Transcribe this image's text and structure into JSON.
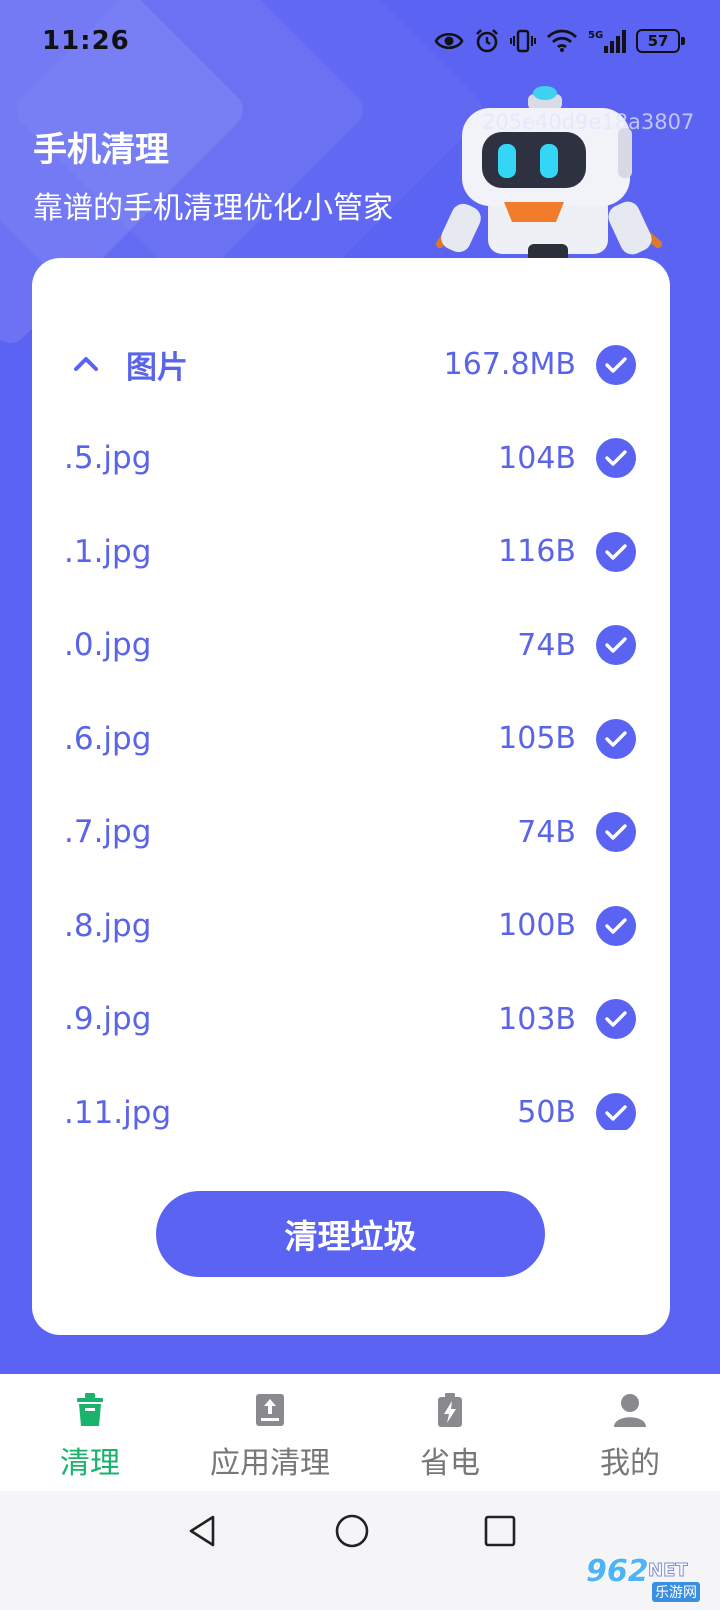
{
  "status_bar": {
    "time": "11:26",
    "battery": "57"
  },
  "header": {
    "title": "手机清理",
    "subtitle": "靠谱的手机清理优化小管家",
    "overlay_id": "205e40d9e18a3807"
  },
  "file_list": {
    "group": {
      "name": "图片",
      "size": "167.8MB",
      "checked": true,
      "expanded": true
    },
    "items": [
      {
        "name": ".5.jpg",
        "size": "104B",
        "checked": true
      },
      {
        "name": ".1.jpg",
        "size": "116B",
        "checked": true
      },
      {
        "name": ".0.jpg",
        "size": "74B",
        "checked": true
      },
      {
        "name": ".6.jpg",
        "size": "105B",
        "checked": true
      },
      {
        "name": ".7.jpg",
        "size": "74B",
        "checked": true
      },
      {
        "name": ".8.jpg",
        "size": "100B",
        "checked": true
      },
      {
        "name": ".9.jpg",
        "size": "103B",
        "checked": true
      },
      {
        "name": ".11.jpg",
        "size": "50B",
        "checked": true
      }
    ]
  },
  "clean_button": {
    "label": "清理垃圾"
  },
  "bottom_nav": {
    "items": [
      {
        "label": "清理",
        "icon": "trash-icon",
        "active": true
      },
      {
        "label": "应用清理",
        "icon": "app-upload-icon",
        "active": false
      },
      {
        "label": "省电",
        "icon": "battery-bolt-icon",
        "active": false
      },
      {
        "label": "我的",
        "icon": "person-icon",
        "active": false
      }
    ]
  },
  "watermark": {
    "brand": "962",
    "suffix": "NET",
    "cn": "乐游网"
  },
  "colors": {
    "primary": "#5b63f3",
    "active_tab": "#19b36b",
    "inactive_tab": "#777777",
    "list_text": "#5a64e8"
  }
}
